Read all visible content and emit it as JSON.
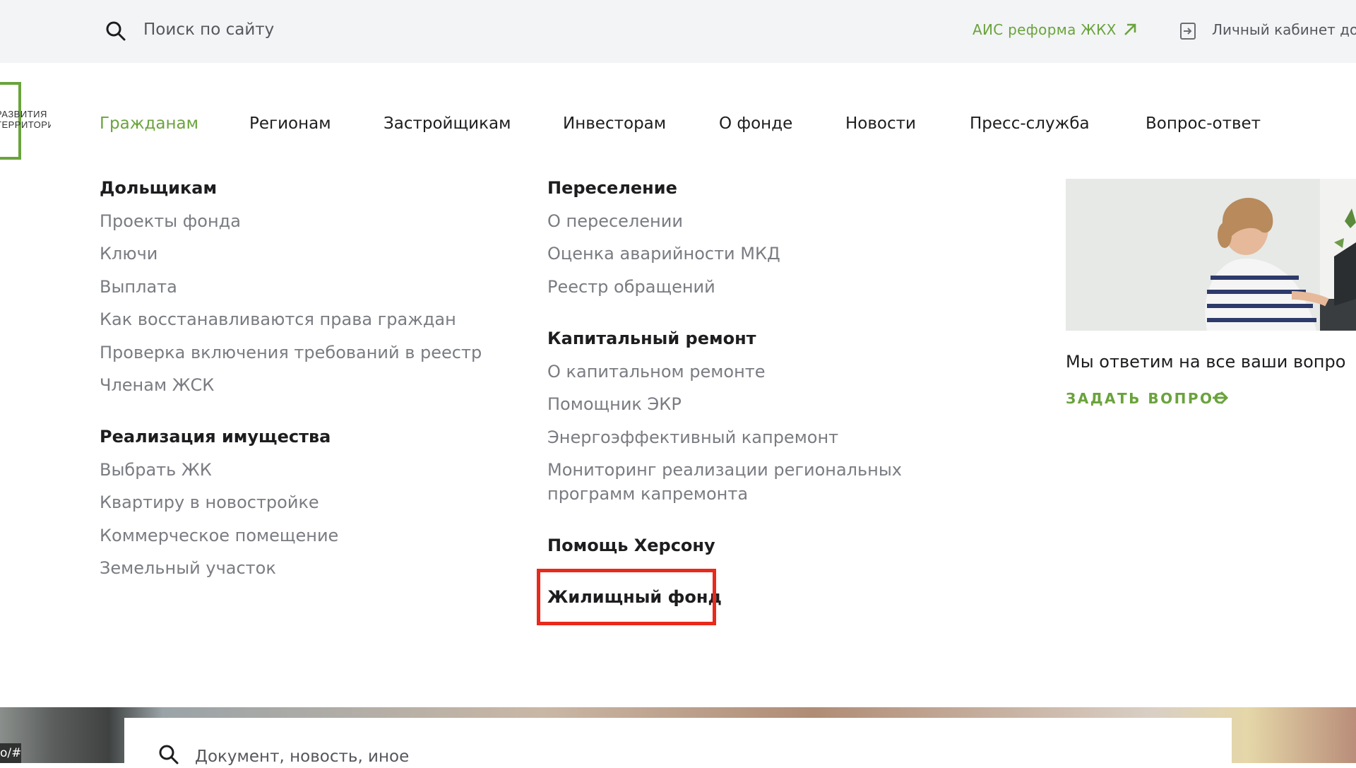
{
  "topbar": {
    "search_placeholder": "Поиск по сайту",
    "ais_link": "АИС реформа ЖКХ",
    "login_link": "Личный кабинет дол"
  },
  "logo": {
    "text_line1": "РАЗВИТИЯ",
    "text_line2": "ТЕРРИТОРИЙ"
  },
  "nav": {
    "items": [
      {
        "label": "Гражданам",
        "active": true
      },
      {
        "label": "Регионам"
      },
      {
        "label": "Застройщикам"
      },
      {
        "label": "Инвесторам"
      },
      {
        "label": "О фонде"
      },
      {
        "label": "Новости"
      },
      {
        "label": "Пресс-служба"
      },
      {
        "label": "Вопрос-ответ"
      }
    ]
  },
  "menu": {
    "col1": {
      "group1": {
        "heading": "Дольщикам",
        "links": [
          "Проекты фонда",
          "Ключи",
          "Выплата",
          "Как восстанавливаются права граждан",
          "Проверка включения требований в реестр",
          "Членам ЖСК"
        ]
      },
      "group2": {
        "heading": "Реализация имущества",
        "links": [
          "Выбрать ЖК",
          "Квартиру в новостройке",
          "Коммерческое помещение",
          "Земельный участок"
        ]
      }
    },
    "col2": {
      "group1": {
        "heading": "Переселение",
        "links": [
          "О переселении",
          "Оценка аварийности МКД",
          "Реестр обращений"
        ]
      },
      "group2": {
        "heading": "Капитальный ремонт",
        "links": [
          "О капитальном ремонте",
          "Помощник ЭКР",
          "Энергоэффективный капремонт",
          "Мониторинг реализации региональных",
          "программ капремонта"
        ]
      },
      "group3": {
        "heading": "Помощь Херсону"
      },
      "group4": {
        "heading": "Жилищный фонд"
      }
    }
  },
  "promo": {
    "text": "Мы ответим на все ваши вопро",
    "cta": "ЗАДАТЬ ВОПРОС"
  },
  "bottom": {
    "search_placeholder": "Документ, новость, иное",
    "url_hint": "o/#"
  },
  "colors": {
    "accent": "#6aa33c",
    "highlight": "#e8291b",
    "topbar_bg": "#f3f4f6"
  }
}
